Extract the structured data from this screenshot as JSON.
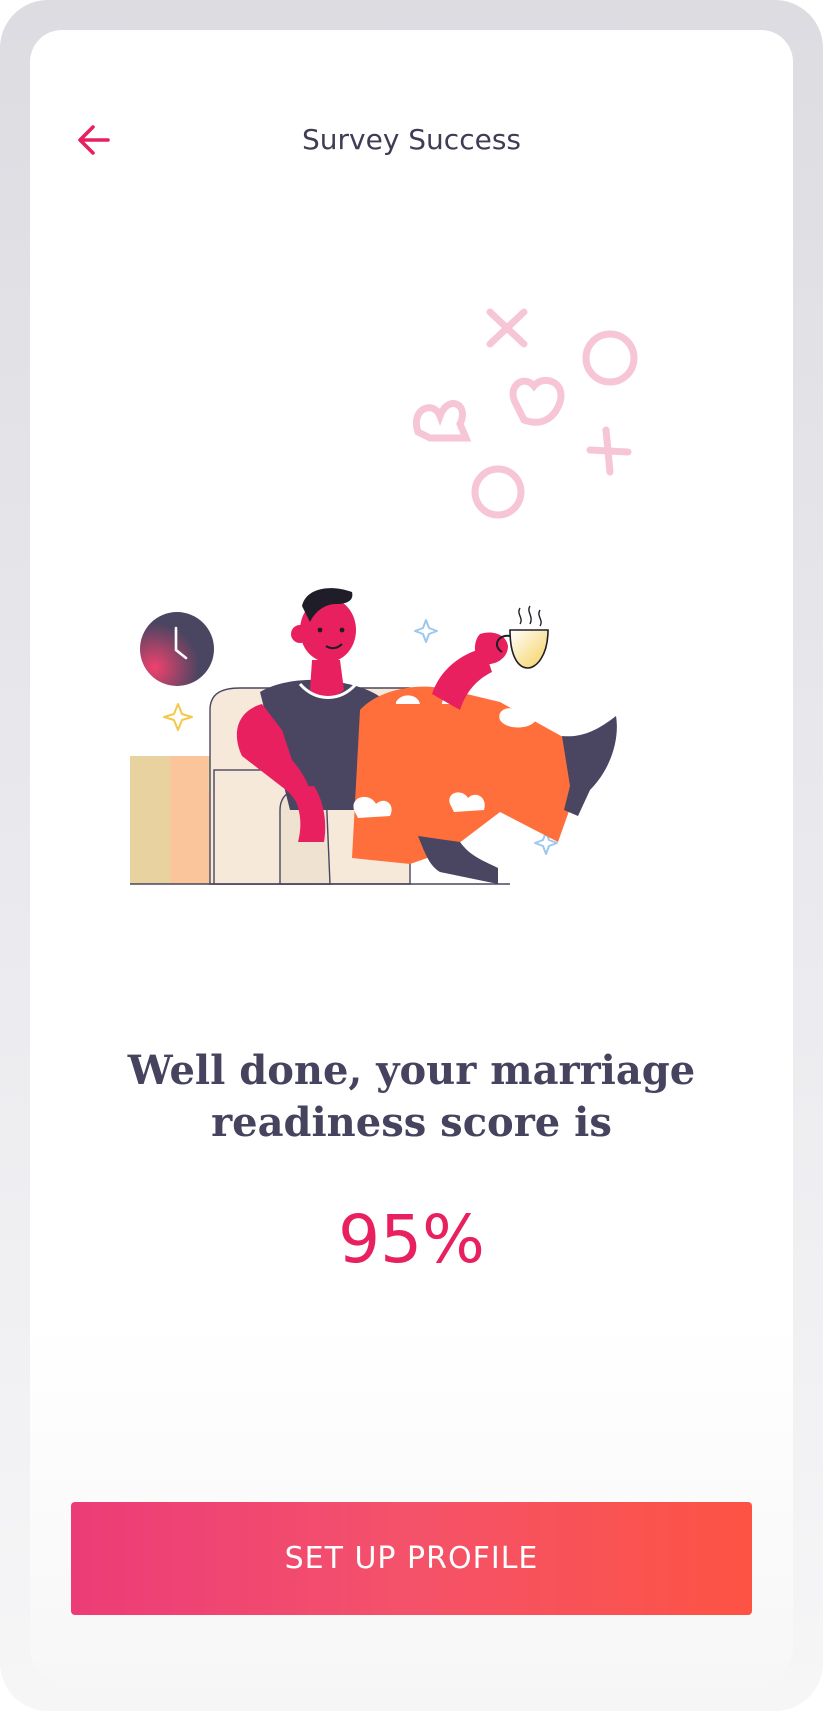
{
  "header": {
    "title": "Survey Success",
    "back_icon": "arrow-left-icon"
  },
  "message": {
    "line1": "Well done, your marriage",
    "line2": "readiness score is"
  },
  "score": {
    "value": "95%"
  },
  "cta": {
    "label": "SET UP PROFILE"
  },
  "colors": {
    "accent": "#e8205f",
    "text_dark": "#3f3d56",
    "button_gradient_start": "#ec3c78",
    "button_gradient_end": "#fd5343",
    "decor_pink": "#f7c6d6"
  }
}
